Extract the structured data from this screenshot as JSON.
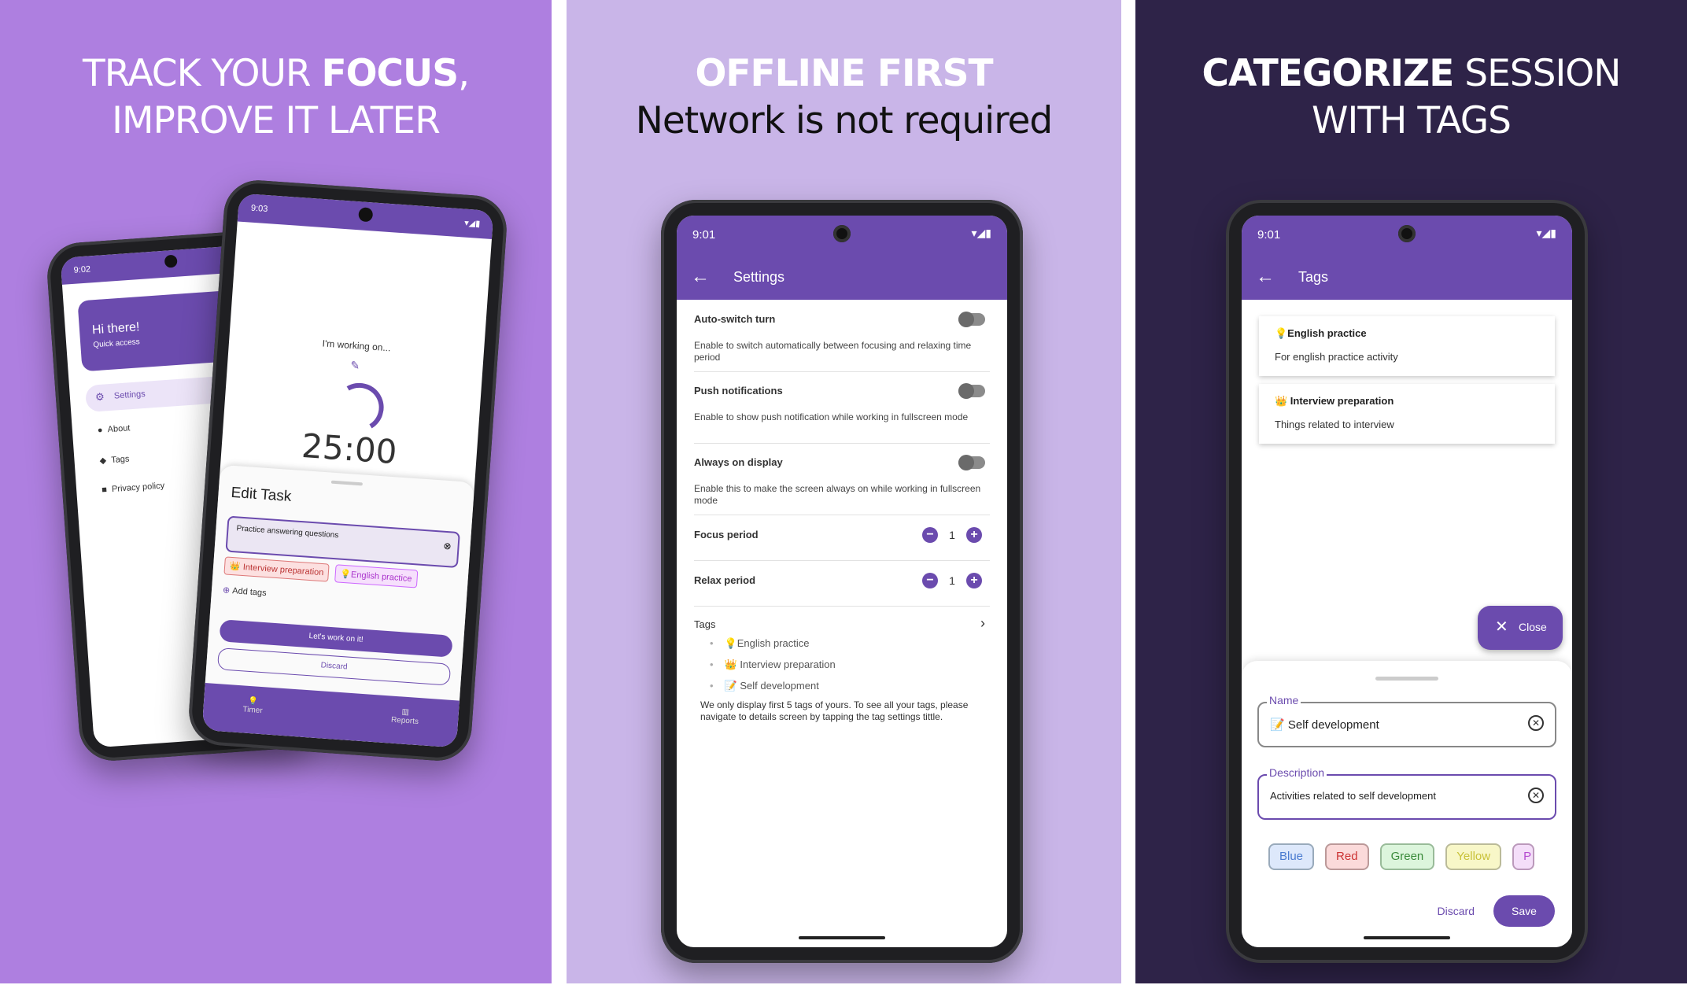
{
  "panel1": {
    "heading_line1_pre": "TRACK YOUR ",
    "heading_line1_bold": "FOCUS",
    "heading_line1_post": ",",
    "heading_line2": "IMPROVE IT LATER",
    "back_phone": {
      "time": "9:02",
      "greeting": "Hi there!",
      "subtitle": "Quick access",
      "menu": [
        "Settings",
        "About",
        "Tags",
        "Privacy policy"
      ]
    },
    "front_phone": {
      "time": "9:03",
      "working_on": "I'm working on...",
      "timer": "25:00",
      "sheet_title": "Edit Task",
      "task_input": "Practice answering questions",
      "tags": [
        "👑 Interview preparation",
        "💡English practice"
      ],
      "add_tags": "Add tags",
      "primary_btn": "Let's work on it!",
      "secondary_btn": "Discard",
      "nav": [
        "Timer",
        "Reports"
      ]
    }
  },
  "panel2": {
    "heading_line1": "OFFLINE FIRST",
    "heading_line2": "Network is not required",
    "time": "9:01",
    "screen_title": "Settings",
    "settings": [
      {
        "label": "Auto-switch turn",
        "desc": "Enable to switch automatically between focusing and relaxing time period"
      },
      {
        "label": "Push notifications",
        "desc": "Enable to show push notification while working in fullscreen mode"
      },
      {
        "label": "Always on display",
        "desc": "Enable this to make the screen always on while working in fullscreen mode"
      }
    ],
    "focus_period": {
      "label": "Focus period",
      "value": "1"
    },
    "relax_period": {
      "label": "Relax period",
      "value": "1"
    },
    "tags_label": "Tags",
    "tags": [
      "💡English practice",
      "👑 Interview preparation",
      "📝 Self development"
    ],
    "tags_note": "We only display first 5 tags of yours. To see all your tags, please navigate to details screen by tapping the tag settings tittle."
  },
  "panel3": {
    "heading_line1_bold": "CATEGORIZE",
    "heading_line1_post": " SESSION",
    "heading_line2": "WITH TAGS",
    "time": "9:01",
    "screen_title": "Tags",
    "cards": [
      {
        "title": "💡English practice",
        "desc": "For english practice activity"
      },
      {
        "title": "👑 Interview preparation",
        "desc": "Things related to interview"
      }
    ],
    "close_btn": "Close",
    "name_label": "Name",
    "name_value": "📝 Self development",
    "desc_label": "Description",
    "desc_value": "Activities related to self development",
    "colors": [
      "Blue",
      "Red",
      "Green",
      "Yellow",
      "P"
    ],
    "discard": "Discard",
    "save": "Save"
  },
  "colors": {
    "accent": "#6b4bae",
    "panel1": "#ae7fe0",
    "panel2": "#c9b5e8",
    "panel3": "#2e2348"
  }
}
